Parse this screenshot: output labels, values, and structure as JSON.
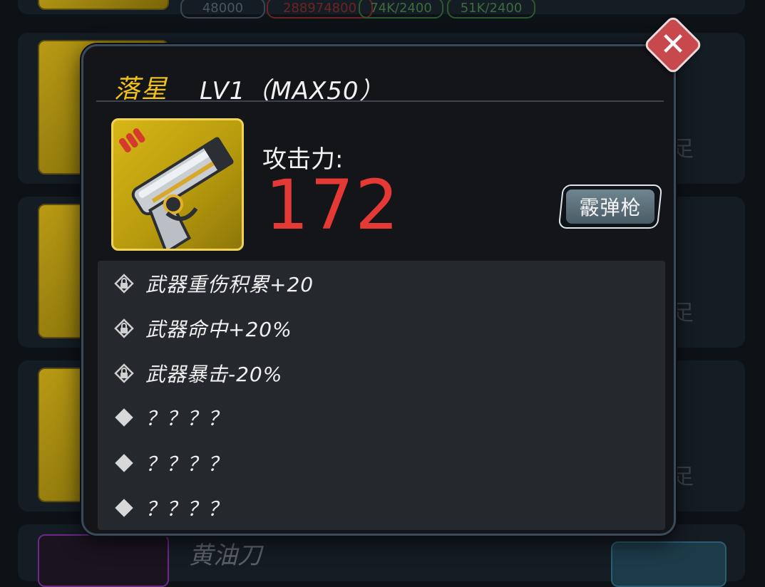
{
  "background": {
    "top_stats": [
      "48000",
      "288974800",
      "74K/2400",
      "51K/2400"
    ],
    "insufficient_labels": [
      "不足",
      "不足",
      "不足"
    ],
    "next_weapon_name": "黄油刀"
  },
  "item": {
    "name": "落星",
    "level_text": "LV1（MAX50）",
    "attack_label": "攻击力:",
    "attack_value": "172",
    "weapon_type": "霰弹枪"
  },
  "attributes": [
    {
      "icon": "lock-icon",
      "text": "武器重伤积累+20"
    },
    {
      "icon": "lock-icon",
      "text": "武器命中+20%"
    },
    {
      "icon": "lock-icon",
      "text": "武器暴击-20%"
    },
    {
      "icon": "diamond-icon",
      "text": "？？？？"
    },
    {
      "icon": "diamond-icon",
      "text": "？？？？"
    },
    {
      "icon": "diamond-icon",
      "text": "？？？？"
    }
  ],
  "colors": {
    "name": "#f1c21b",
    "attack_value": "#e53935",
    "close_button": "#c7484d"
  }
}
